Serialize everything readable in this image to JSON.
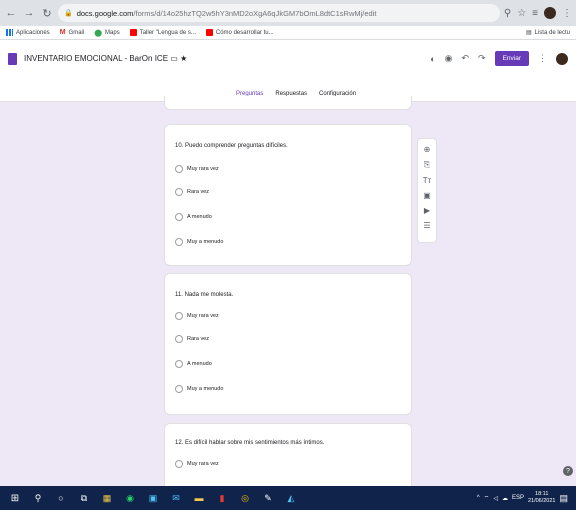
{
  "browser": {
    "url_host": "docs.google.com",
    "url_path": "/forms/d/14o25hzTQ2w5hY3nMD2oXgA6qJkGM7bOmL8dtC1sRwMj/edit"
  },
  "bookmarks": [
    {
      "label": "Aplicaciones"
    },
    {
      "label": "Gmail"
    },
    {
      "label": "Maps"
    },
    {
      "label": "Taller \"Lengua de s..."
    },
    {
      "label": "Cómo desarrollar tu..."
    }
  ],
  "bookmarks_right": "Lista de lectu",
  "form": {
    "title": "INVENTARIO EMOCIONAL - BarOn ICE",
    "send_label": "Enviar",
    "tabs": [
      "Preguntas",
      "Respuestas",
      "Configuración"
    ]
  },
  "questions": [
    {
      "text": "10. Puedo comprender preguntas difíciles.",
      "options": [
        "Muy rara vez",
        "Rara vez",
        "A menudo",
        "Muy a menudo"
      ]
    },
    {
      "text": "11. Nada me molesta.",
      "options": [
        "Muy rara vez",
        "Rara vez",
        "A menudo",
        "Muy a menudo"
      ]
    },
    {
      "text": "12. Es difícil hablar sobre mis sentimientos más íntimos.",
      "options": [
        "Muy rara vez"
      ]
    }
  ],
  "taskbar": {
    "tray_lang": "ESP",
    "time": "18:11",
    "date": "21/06/2021"
  },
  "colors": {
    "accent": "#673ab7",
    "background": "#ede7f6",
    "taskbar": "#10234b"
  }
}
